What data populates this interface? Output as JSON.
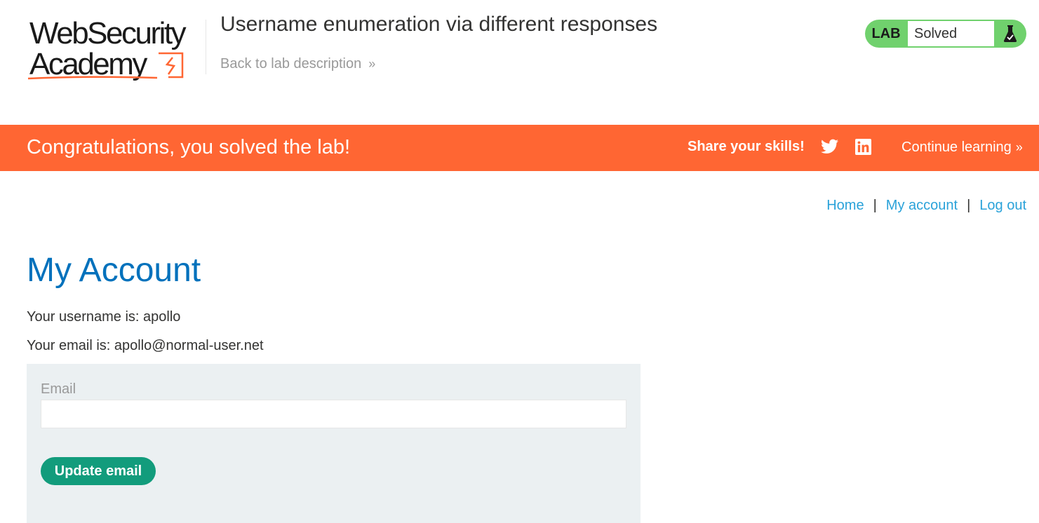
{
  "header": {
    "logo": {
      "line1": "WebSecurity",
      "line2": "Academy"
    },
    "lab_title": "Username enumeration via different responses",
    "back_link": "Back to lab description",
    "back_chevron": "»",
    "lab_status": {
      "label": "LAB",
      "state": "Solved",
      "icon": "flask-icon"
    }
  },
  "banner": {
    "message": "Congratulations, you solved the lab!",
    "share_label": "Share your skills!",
    "share_icons": [
      "twitter-icon",
      "linkedin-icon"
    ],
    "continue_link": "Continue learning",
    "continue_chevron": "»"
  },
  "nav": {
    "home": "Home",
    "my_account": "My account",
    "log_out": "Log out",
    "separator": "|"
  },
  "account": {
    "title": "My Account",
    "username_line": "Your username is: apollo",
    "email_line": "Your email is: apollo@normal-user.net"
  },
  "form": {
    "email_label": "Email",
    "email_value": "",
    "button_label": "Update email"
  },
  "colors": {
    "brand_orange": "#ff6633",
    "lab_green": "#70d16d",
    "link_blue": "#2aa2d9",
    "title_blue": "#0071bc",
    "button_teal": "#129c7c",
    "panel_bg": "#ebf0f2"
  }
}
